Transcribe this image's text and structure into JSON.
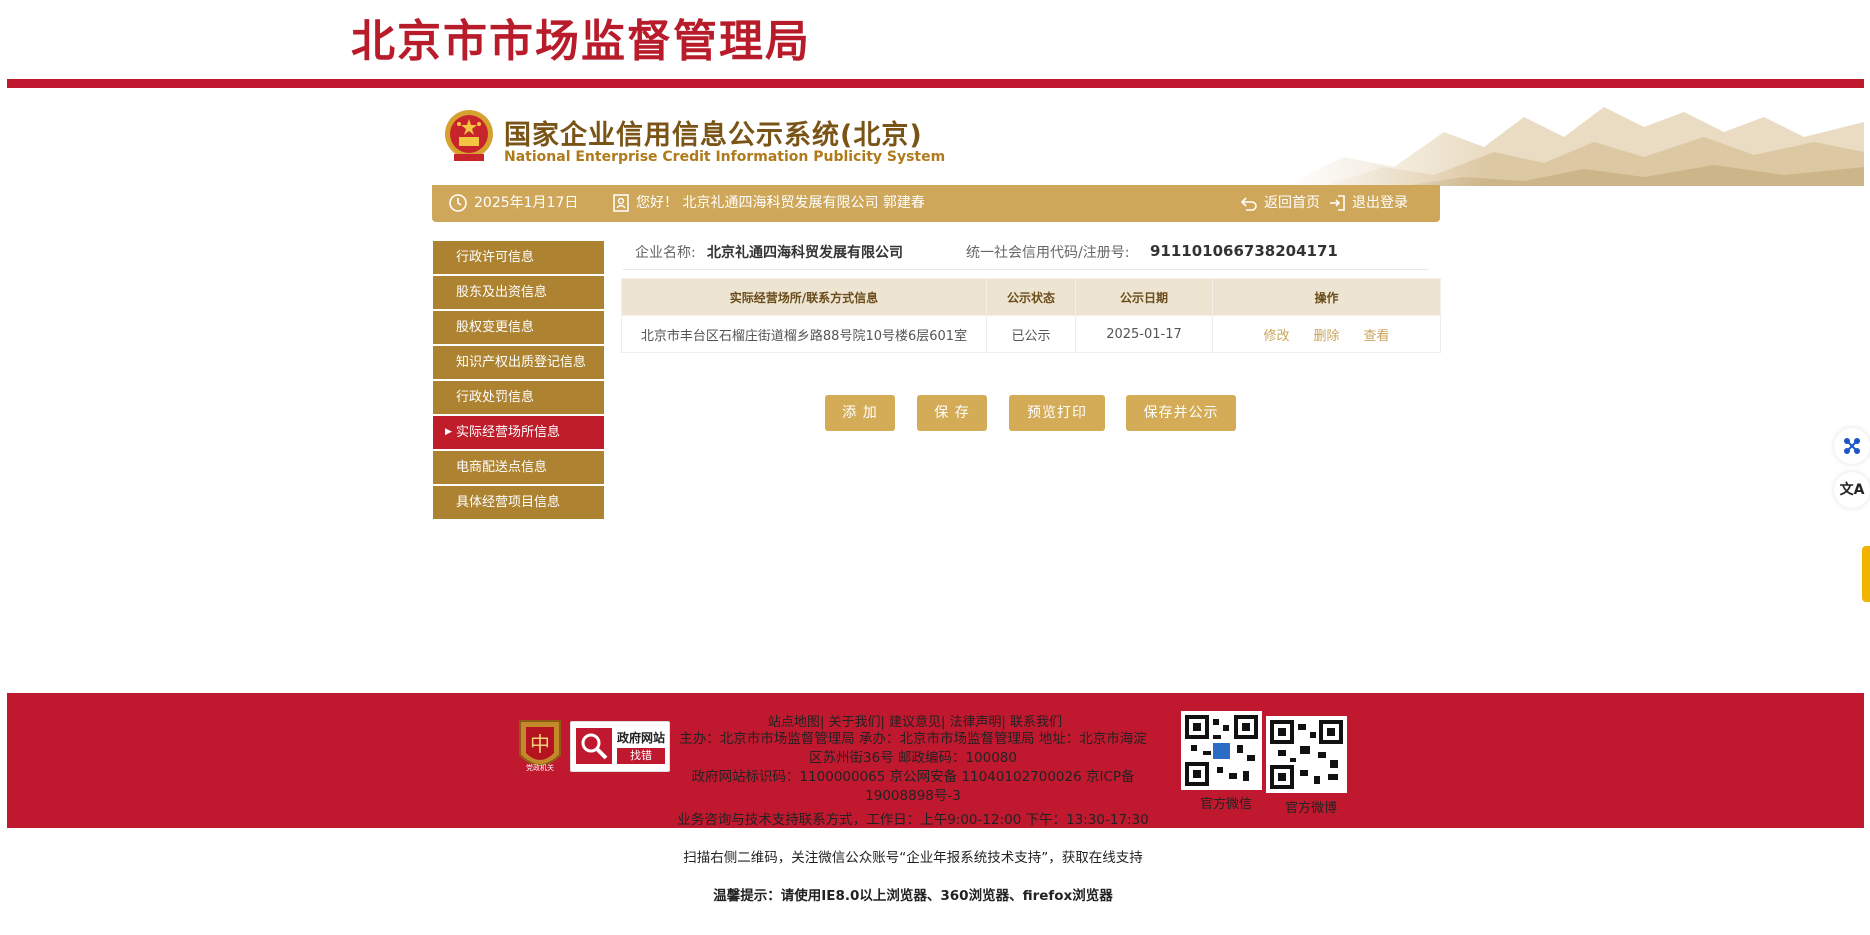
{
  "header": {
    "site_title": "北京市市场监督管理局"
  },
  "banner": {
    "title": "国家企业信用信息公示系统(北京)",
    "title_en": "National Enterprise Credit Information Publicity System"
  },
  "status_bar": {
    "date": "2025年1月17日",
    "greeting": "您好！ 北京礼通四海科贸发展有限公司  郭建春",
    "home_label": "返回首页",
    "logout_label": "退出登录"
  },
  "sidebar": {
    "items": [
      {
        "label": "行政许可信息"
      },
      {
        "label": "股东及出资信息"
      },
      {
        "label": "股权变更信息"
      },
      {
        "label": "知识产权出质登记信息"
      },
      {
        "label": "行政处罚信息"
      },
      {
        "label": "实际经营场所信息",
        "active": true
      },
      {
        "label": "电商配送点信息"
      },
      {
        "label": "具体经营项目信息"
      }
    ]
  },
  "company": {
    "name_label": "企业名称:",
    "name": "北京礼通四海科贸发展有限公司",
    "code_label": "统一社会信用代码/注册号:",
    "code": "911101066738204171"
  },
  "table": {
    "headers": [
      "实际经营场所/联系方式信息",
      "公示状态",
      "公示日期",
      "操作"
    ],
    "rows": [
      {
        "address": "北京市丰台区石榴庄街道榴乡路88号院10号楼6层601室",
        "status": "已公示",
        "date": "2025-01-17",
        "ops": [
          "修改",
          "删除",
          "查看"
        ]
      }
    ]
  },
  "actions": {
    "add": "添 加",
    "save": "保 存",
    "preview": "预览打印",
    "save_publish": "保存并公示"
  },
  "float": {
    "translate_icon": "文A"
  },
  "footer": {
    "links": [
      "站点地图",
      "关于我们",
      "建议意见",
      "法律声明",
      "联系我们"
    ],
    "line1": "主办：北京市市场监督管理局 承办：北京市市场监督管理局 地址：北京市海淀区苏州街36号 邮政编码：100080",
    "line2": "政府网站标识码：1100000065     京公网安备 11040102700026     京ICP备19008898号-3",
    "line3": "业务咨询与技术支持联系方式，工作日：上午9:00-12:00 下午：13:30-17:30",
    "line4": "扫描右侧二维码，关注微信公众账号“企业年报系统技术支持”，获取在线支持",
    "line5": "温馨提示：请使用IE8.0以上浏览器、360浏览器、firefox浏览器",
    "badge_party": "党政机关",
    "badge_gov_line1": "政府网站",
    "badge_gov_line2": "找错",
    "qr1_label": "官方微信",
    "qr2_label": "官方微博"
  },
  "colors": {
    "brand_red": "#c0192f",
    "gold": "#cfa75b",
    "sidebar_gold": "#ad8331",
    "button_gold": "#d4ac57"
  }
}
